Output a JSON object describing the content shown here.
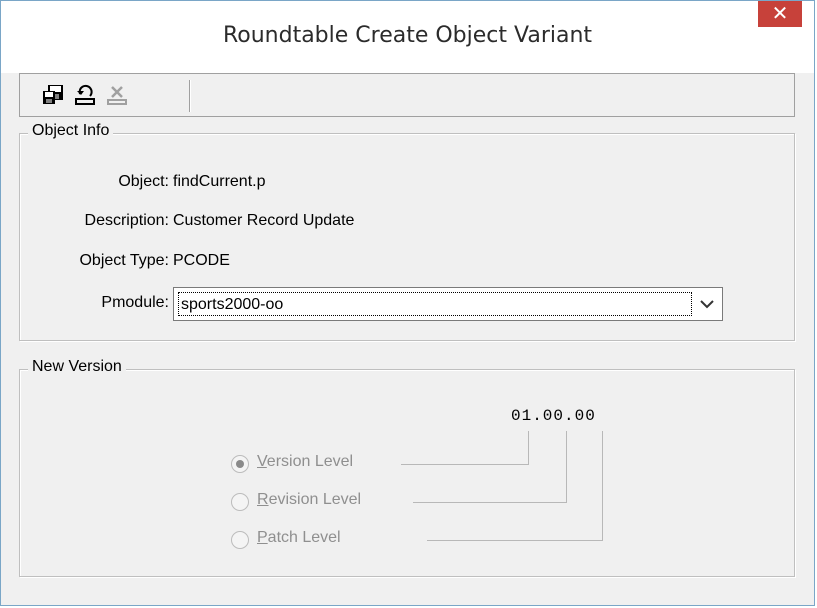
{
  "window": {
    "title": "Roundtable Create Object Variant",
    "close_glyph": "✕"
  },
  "toolbar": {
    "buttons": [
      {
        "icon": "save-icon",
        "enabled": true
      },
      {
        "icon": "undo-icon",
        "enabled": true
      },
      {
        "icon": "delete-icon",
        "enabled": false
      }
    ]
  },
  "object_info": {
    "group_label": "Object Info",
    "object_label": "Object:",
    "object_value": "findCurrent.p",
    "description_label": "Description:",
    "description_value": "Customer Record Update",
    "type_label": "Object Type:",
    "type_value": "PCODE",
    "pmodule_label": "Pmodule:",
    "pmodule_value": "sports2000-oo"
  },
  "new_version": {
    "group_label": "New Version",
    "version_string": "01.00.00",
    "options": [
      {
        "mnemonic": "V",
        "rest": "ersion Level",
        "checked": true
      },
      {
        "mnemonic": "R",
        "rest": "evision Level",
        "checked": false
      },
      {
        "mnemonic": "P",
        "rest": "atch Level",
        "checked": false
      }
    ]
  },
  "colors": {
    "close_bg": "#c7413a",
    "disabled_text": "#8f8f8f",
    "dialog_bg": "#f0f0f0"
  }
}
